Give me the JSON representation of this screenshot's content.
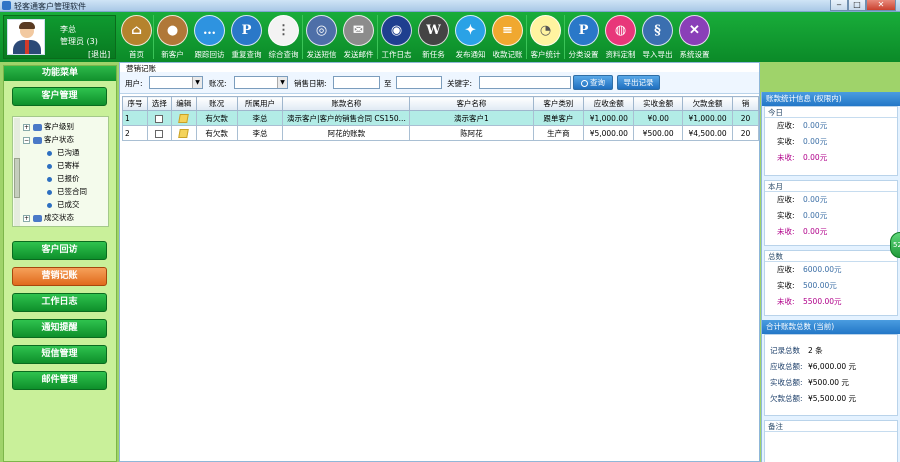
{
  "app": {
    "title": "轻客通客户管理软件"
  },
  "window": {
    "minimize": "‒",
    "maximize": "□",
    "close": "✕"
  },
  "user": {
    "name": "李总",
    "role": "管理员 (3)",
    "logout": "[退出]"
  },
  "toolbar": [
    {
      "label": "首页",
      "icon": "home-icon",
      "color": "#b5832d",
      "glyph": "⌂"
    },
    {
      "label": "新客户",
      "icon": "person-icon",
      "color": "#b07838",
      "glyph": "●"
    },
    {
      "label": "跟踪回访",
      "icon": "chat-icon",
      "color": "#2e93e0",
      "glyph": "…"
    },
    {
      "label": "重复查询",
      "icon": "p-icon",
      "color": "#2a78c8",
      "glyph": "P"
    },
    {
      "label": "综合查询",
      "icon": "dots-icon",
      "color": "#f3f3f3",
      "glyph": "⋮"
    },
    {
      "label": "发送短信",
      "icon": "sms-icon",
      "color": "#4e6fa8",
      "glyph": "◎"
    },
    {
      "label": "发送邮件",
      "icon": "mail-icon",
      "color": "#8c8c8c",
      "glyph": "✉"
    },
    {
      "label": "工作日志",
      "icon": "log-icon",
      "color": "#1f3f8f",
      "glyph": "◉"
    },
    {
      "label": "新任务",
      "icon": "wordpress-icon",
      "color": "#444444",
      "glyph": "W"
    },
    {
      "label": "发布通知",
      "icon": "twitter-icon",
      "color": "#2aa2e6",
      "glyph": "✦"
    },
    {
      "label": "收款记账",
      "icon": "ledger-icon",
      "color": "#f0a830",
      "glyph": "≡"
    },
    {
      "label": "客户统计",
      "icon": "chart-icon",
      "color": "#fff3a0",
      "glyph": "◔"
    },
    {
      "label": "分类设置",
      "icon": "p-icon",
      "color": "#2a78c8",
      "glyph": "P"
    },
    {
      "label": "资料定制",
      "icon": "dribbble-icon",
      "color": "#e8377a",
      "glyph": "◍"
    },
    {
      "label": "导入导出",
      "icon": "python-icon",
      "color": "#3b6fb0",
      "glyph": "§"
    },
    {
      "label": "系统设置",
      "icon": "tools-icon",
      "color": "#8a3fb8",
      "glyph": "✕"
    }
  ],
  "menu": {
    "title": "功能菜单",
    "buttons": [
      "客户管理",
      "客户回访",
      "营销记账",
      "工作日志",
      "通知提醒",
      "短信管理",
      "邮件管理"
    ],
    "tree": [
      {
        "label": "客户级别",
        "type": "folder",
        "exp": "+"
      },
      {
        "label": "客户状态",
        "type": "folder",
        "exp": "−"
      },
      {
        "label": "已沟通",
        "type": "leaf"
      },
      {
        "label": "已寄样",
        "type": "leaf"
      },
      {
        "label": "已报价",
        "type": "leaf"
      },
      {
        "label": "已签合同",
        "type": "leaf"
      },
      {
        "label": "已成交",
        "type": "leaf"
      },
      {
        "label": "成交状态",
        "type": "folder",
        "exp": "+"
      }
    ]
  },
  "filter": {
    "group_label": "营销记账",
    "user_label": "用户:",
    "status_label": "账况:",
    "date_label": "销售日期:",
    "to_label": "至",
    "keyword_label": "关键字:",
    "search_button": "查询",
    "export_button": "导出记录"
  },
  "table": {
    "columns": [
      "序号",
      "选择",
      "编辑",
      "账况",
      "所属用户",
      "账款名称",
      "客户名称",
      "客户类别",
      "应收金额",
      "实收金额",
      "欠款金额",
      "销"
    ],
    "rows": [
      [
        "1",
        "",
        "",
        "有欠款",
        "李总",
        "演示客户|客户的销售合同 CS150...",
        "演示客户1",
        "跟单客户",
        "¥1,000.00",
        "¥0.00",
        "¥1,000.00",
        "20"
      ],
      [
        "2",
        "",
        "",
        "有欠款",
        "李总",
        "阿花的账款",
        "陈阿花",
        "生产商",
        "¥5,000.00",
        "¥500.00",
        "¥4,500.00",
        "20"
      ]
    ]
  },
  "stats": {
    "title": "账款统计信息 (权限内)",
    "today": {
      "label": "今日",
      "receivable": "0.00元",
      "received": "0.00元",
      "unreceived": "0.00元"
    },
    "month": {
      "label": "本月",
      "receivable": "0.00元",
      "received": "0.00元",
      "unreceived": "0.00元"
    },
    "total": {
      "label": "总数",
      "receivable": "6000.00元",
      "received": "500.00元",
      "unreceived": "5500.00元"
    },
    "k_receivable": "应收:",
    "k_received": "实收:",
    "k_unreceived": "未收:",
    "summary_title": "合计账款总数 (当前)",
    "summary": {
      "records_label": "记录总数",
      "records": "2 条",
      "receivable_label": "应收总额:",
      "receivable": "¥6,000.00 元",
      "received_label": "实收总额:",
      "received": "¥500.00 元",
      "owed_label": "欠款总额:",
      "owed": "¥5,500.00 元"
    },
    "notes_title": "备注"
  },
  "side_tab": "52"
}
